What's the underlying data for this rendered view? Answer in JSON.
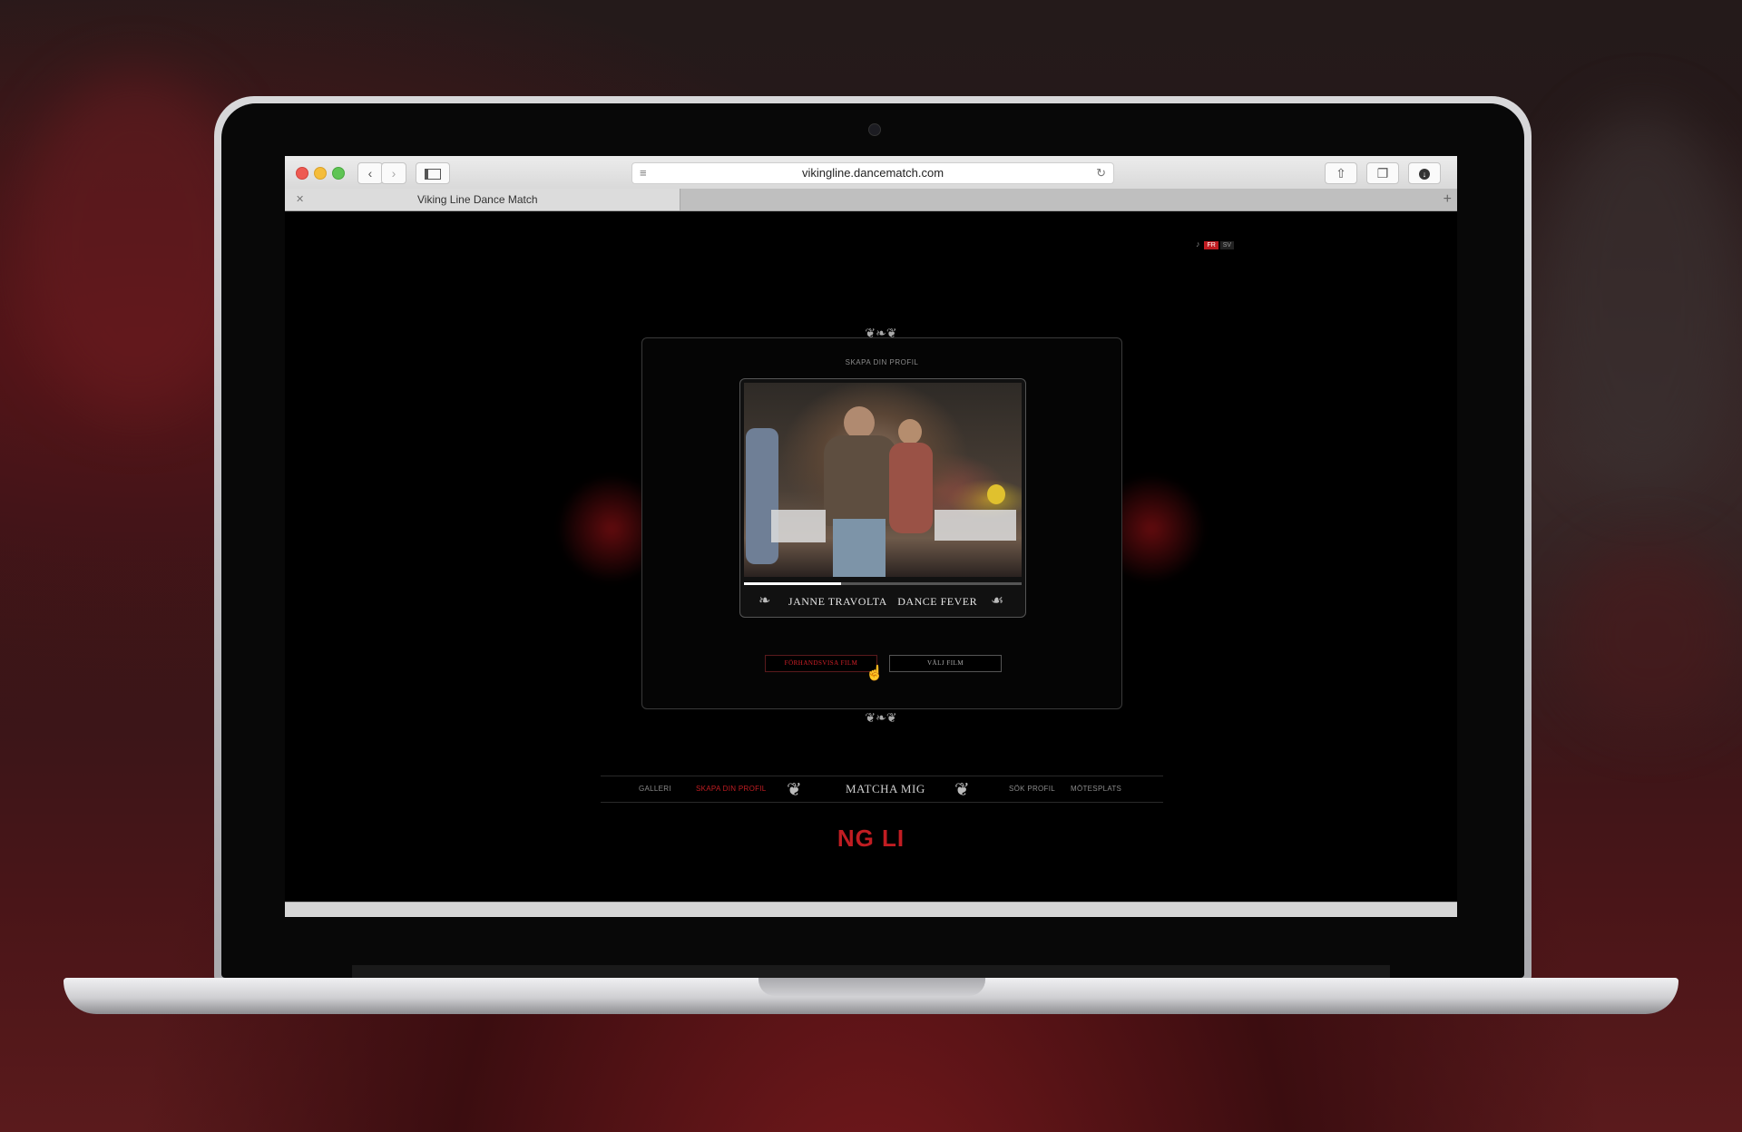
{
  "browser": {
    "url": "vikingline.dancematch.com",
    "tab_title": "Viking Line Dance Match",
    "tab_close": "✕",
    "new_tab": "+"
  },
  "language": {
    "options": [
      "FR",
      "SV"
    ]
  },
  "panel": {
    "title": "SKAPA DIN PROFIL",
    "video": {
      "caption_name": "JANNE TRAVOLTA",
      "caption_subtitle": "DANCE FEVER",
      "progress": 0.35
    },
    "buttons": {
      "preview_label": "FÖRHANDSVISA FILM",
      "choose_label": "VÄLJ FILM"
    }
  },
  "nav": {
    "items_left": [
      "GALLERI",
      "SKAPA DIN PROFIL"
    ],
    "center": "MATCHA MIG",
    "items_right": [
      "SÖK PROFIL",
      "MÖTESPLATS"
    ],
    "active": "SKAPA DIN PROFIL"
  },
  "logo": {
    "text": "NG LI"
  },
  "colors": {
    "accent": "#c11d22",
    "background": "#000000"
  }
}
